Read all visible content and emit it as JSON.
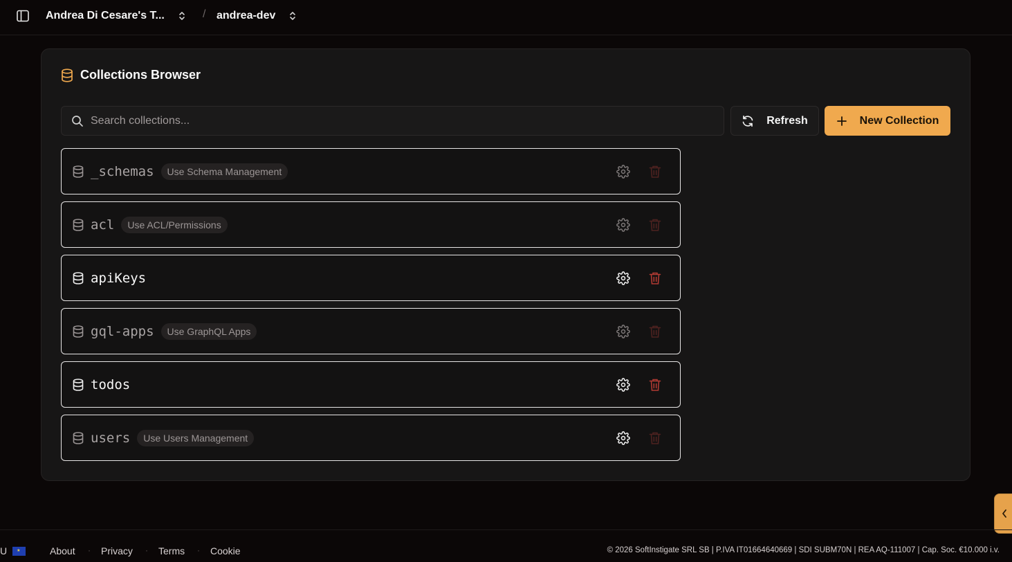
{
  "topbar": {
    "team_label": "Andrea Di Cesare's T...",
    "separator": "/",
    "project_label": "andrea-dev"
  },
  "browser": {
    "title": "Collections Browser",
    "search_placeholder": "Search collections...",
    "refresh_label": "Refresh",
    "new_collection_label": "New Collection"
  },
  "collections": [
    {
      "name": "_schemas",
      "badge": "Use Schema Management"
    },
    {
      "name": "acl",
      "badge": "Use ACL/Permissions"
    },
    {
      "name": "apiKeys",
      "badge": ""
    },
    {
      "name": "gql-apps",
      "badge": "Use GraphQL Apps"
    },
    {
      "name": "todos",
      "badge": ""
    },
    {
      "name": "users",
      "badge": "Use Users Management"
    }
  ],
  "footer": {
    "lang": "U",
    "about": "About",
    "privacy": "Privacy",
    "terms": "Terms",
    "cookie": "Cookie",
    "legal": "© 2026 SoftInstigate SRL SB | P.IVA IT01664640669 | SDI SUBM70N | REA AQ-111007 | Cap. Soc. €10.000 i.v."
  },
  "colors": {
    "accent": "#f0a94e",
    "danger": "#a8322c",
    "background": "#0b0707"
  }
}
